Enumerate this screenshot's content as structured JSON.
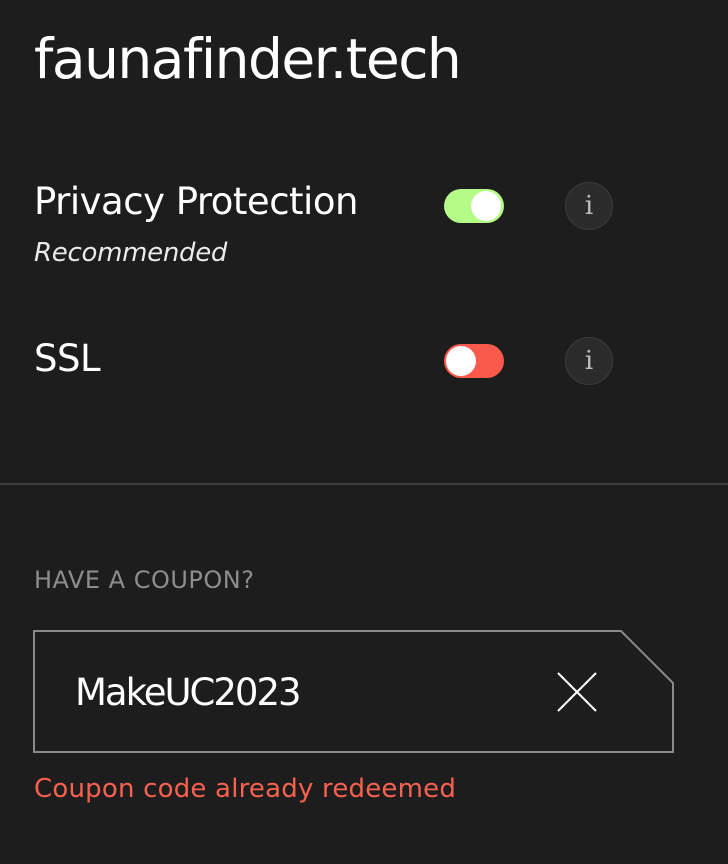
{
  "domain": {
    "name": "faunafinder.tech"
  },
  "options": {
    "privacy": {
      "label": "Privacy Protection",
      "sublabel": "Recommended",
      "enabled": true,
      "info_icon": "info-icon"
    },
    "ssl": {
      "label": "SSL",
      "enabled": false,
      "info_icon": "info-icon"
    }
  },
  "coupon": {
    "heading": "HAVE A COUPON?",
    "value": "MakeUC2023",
    "clear_icon": "close-icon",
    "error": "Coupon code already redeemed"
  },
  "colors": {
    "background": "#1d1d1d",
    "toggle_on": "#b4fb88",
    "toggle_off": "#fa5a4b",
    "error": "#f8604f",
    "muted": "#8d8d8d"
  }
}
